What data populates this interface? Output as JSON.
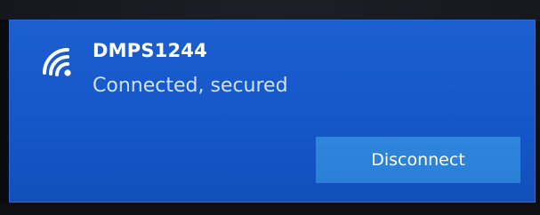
{
  "network": {
    "name": "DMPS1244",
    "status": "Connected, secured",
    "icon": "wifi-icon"
  },
  "actions": {
    "disconnect_label": "Disconnect"
  },
  "colors": {
    "panel": "#1557c8",
    "button": "#2a7fd6",
    "text": "#ffffff",
    "status_text": "#cfe2ff"
  }
}
